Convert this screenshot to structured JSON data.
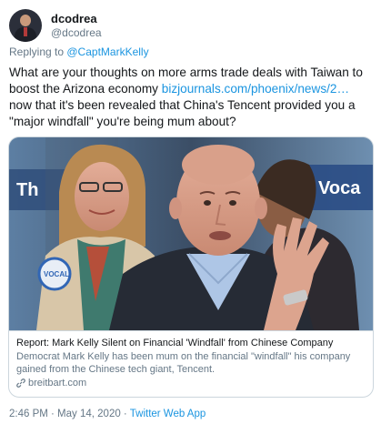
{
  "user": {
    "display_name": "dcodrea",
    "handle": "@dcodrea",
    "avatar_icon": "user-avatar"
  },
  "reply": {
    "prefix": "Replying to ",
    "to": "@CaptMarkKelly"
  },
  "tweet": {
    "text_before_link": "What are your thoughts on more arms trade deals with Taiwan to boost the Arizona economy ",
    "link": "bizjournals.com/phoenix/news/2…",
    "text_after_link": " now that it's been revealed that China's Tencent provided you a \"major windfall\" you're being mum about?"
  },
  "card": {
    "image_banner_left": "Th",
    "image_banner_right": "Voca",
    "badge_text": "VOCAL",
    "title": "Report: Mark Kelly Silent on Financial 'Windfall' from Chinese Company",
    "description": "Democrat Mark Kelly has been mum on the financial \"windfall\" his company gained from the Chinese tech giant, Tencent.",
    "domain": "breitbart.com"
  },
  "footer": {
    "timestamp": "2:46 PM · May 14, 2020 · ",
    "source": "Twitter Web App"
  },
  "colors": {
    "link": "#1b95e0",
    "muted": "#657786",
    "text": "#14171a",
    "border": "#ccd6dd"
  }
}
